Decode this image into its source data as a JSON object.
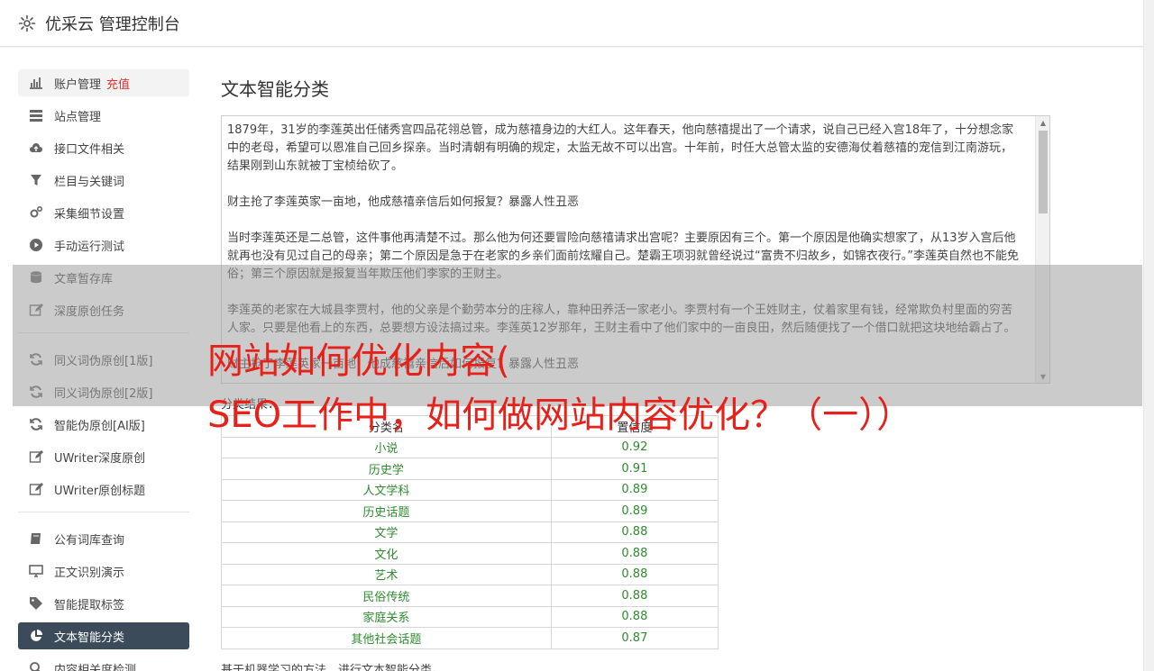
{
  "header": {
    "title": "优采云 管理控制台",
    "icon": "gear-icon"
  },
  "sidebar": {
    "group1": [
      {
        "label": "账户管理",
        "badge": "充值",
        "icon": "bar-chart-icon"
      },
      {
        "label": "站点管理",
        "icon": "server-icon"
      },
      {
        "label": "接口文件相关",
        "icon": "cloud-upload-icon"
      },
      {
        "label": "栏目与关键词",
        "icon": "filter-icon"
      },
      {
        "label": "采集细节设置",
        "icon": "gears-icon"
      },
      {
        "label": "手动运行测试",
        "icon": "play-circle-icon"
      },
      {
        "label": "文章暂存库",
        "icon": "database-icon"
      },
      {
        "label": "深度原创任务",
        "icon": "edit-icon"
      }
    ],
    "group2": [
      {
        "label": "同义词伪原创[1版]",
        "icon": "refresh-icon"
      },
      {
        "label": "同义词伪原创[2版]",
        "icon": "refresh-icon"
      },
      {
        "label": "智能伪原创[AI版]",
        "icon": "refresh-icon"
      },
      {
        "label": "UWriter深度原创",
        "icon": "edit-icon"
      },
      {
        "label": "UWriter原创标题",
        "icon": "edit-icon"
      }
    ],
    "group3": [
      {
        "label": "公有词库查询",
        "icon": "book-icon"
      },
      {
        "label": "正文识别演示",
        "icon": "desktop-icon"
      },
      {
        "label": "智能提取标签",
        "icon": "tag-icon"
      },
      {
        "label": "文本智能分类",
        "icon": "pie-chart-icon"
      },
      {
        "label": "内容相关度检测",
        "icon": "search-icon"
      }
    ]
  },
  "main": {
    "title": "文本智能分类",
    "text_paragraphs": [
      "1879年，31岁的李莲英出任储秀宫四品花翎总管，成为慈禧身边的大红人。这年春天，他向慈禧提出了一个请求，说自己已经入宫18年了，十分想念家中的老母，希望可以恩准自己回乡探亲。当时清朝有明确的规定，太监无故不可以出宫。十年前，时任大总管太监的安德海仗着慈禧的宠信到江南游玩，结果刚到山东就被丁宝桢给砍了。",
      "财主抢了李莲英家一亩地，他成慈禧亲信后如何报复？暴露人性丑恶",
      "当时李莲英还是二总管，这件事他再清楚不过。那么他为何还要冒险向慈禧请求出宫呢？主要原因有三个。第一个原因是他确实想家了，从13岁入宫后他就再也没有见过自己的母亲；第二个原因是急于在老家的乡亲们面前炫耀自己。楚霸王项羽就曾经说过“富贵不归故乡，如锦衣夜行。”李莲英自然也不能免俗；第三个原因就是报复当年欺压他们李家的王财主。",
      "李莲英的老家在大城县李贾村，他的父亲是个勤劳本分的庄稼人，靠种田养活一家老小。李贾村有一个王姓财主，仗着家里有钱，经常欺负村里面的穷苦人家。只要是他看上的东西，总要想方设法搞过来。李莲英12岁那年，王财主看中了他们家中的一亩良田，然后随便找了一个借口就把这块地给霸占了。",
      "财主抢了李莲英家一亩地，他成慈禧亲信后如何报复？暴露人性丑恶"
    ],
    "result_label": "分类结果：",
    "table_headers": [
      "分类名",
      "置信度"
    ],
    "table_rows": [
      [
        "小说",
        "0.92"
      ],
      [
        "历史学",
        "0.91"
      ],
      [
        "人文学科",
        "0.89"
      ],
      [
        "历史话题",
        "0.89"
      ],
      [
        "文学",
        "0.88"
      ],
      [
        "文化",
        "0.88"
      ],
      [
        "艺术",
        "0.88"
      ],
      [
        "民俗传统",
        "0.88"
      ],
      [
        "家庭关系",
        "0.88"
      ],
      [
        "其他社会话题",
        "0.87"
      ]
    ],
    "footnote": "基于机器学习的方法，进行文本智能分类。"
  },
  "overlay": {
    "line1": "网站如何优化内容(",
    "line2": "SEO工作中，如何做网站内容优化？（一））"
  },
  "colors": {
    "accent_red": "#e52e2e",
    "active_bg": "#3c4b5a",
    "value_green": "#2e8b2e",
    "overlay_red": "#e8201a"
  }
}
